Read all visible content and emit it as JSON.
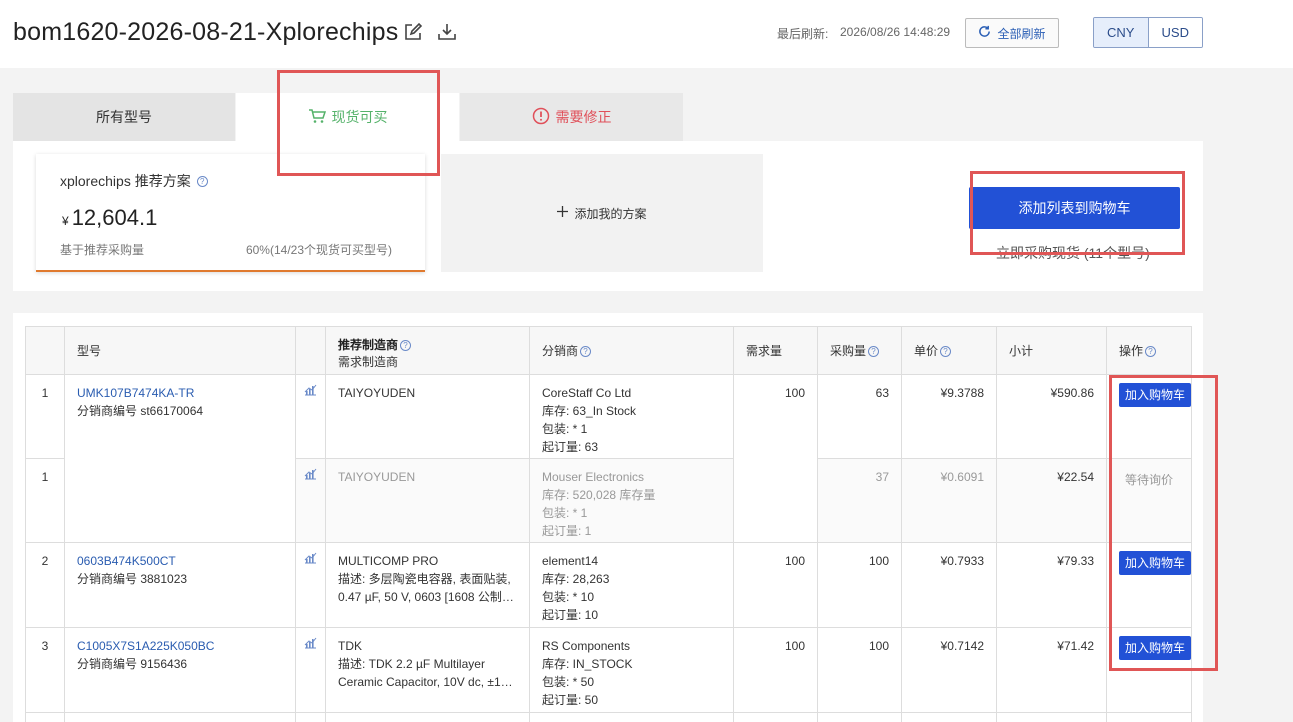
{
  "header": {
    "title": "bom1620-2026-08-21-Xplorechips",
    "refresh_label": "最后刷新:",
    "refresh_time": "2026/08/26 14:48:29",
    "refresh_all": "全部刷新",
    "currencies": [
      "CNY",
      "USD"
    ],
    "active_currency": "CNY"
  },
  "tabs": {
    "all": "所有型号",
    "in_stock": "现货可买",
    "needs_fix": "需要修正"
  },
  "plan_card": {
    "title": "xplorechips 推荐方案",
    "currency_symbol": "¥",
    "price": "12,604.1",
    "basis": "基于推荐采购量",
    "coverage": "60%(14/23个现货可买型号)"
  },
  "add_plan": "添加我的方案",
  "cart": {
    "add_list_button": "添加列表到购物车",
    "buy_now": "立即采购现货 (11个型号)"
  },
  "table": {
    "headers": {
      "part": "型号",
      "mfr_recommended": "推荐制造商",
      "mfr_required": "需求制造商",
      "distributor": "分销商",
      "demand_qty": "需求量",
      "purchase_qty": "采购量",
      "unit_price": "单价",
      "subtotal": "小计",
      "action": "操作"
    },
    "rows": [
      {
        "idx": "1",
        "part": "UMK107B7474KA-TR",
        "dist_no": "分销商编号 st66170064",
        "mfr": "TAIYOYUDEN",
        "desc": "",
        "distributor": "CoreStaff Co Ltd",
        "stock": "库存: 63_In Stock",
        "pack": "包装: * 1",
        "moq": "起订量: 63",
        "demand": "100",
        "purchase": "63",
        "price": "¥9.3788",
        "subtotal": "¥590.86",
        "action": "加入购物车"
      },
      {
        "idx": "1",
        "part": "",
        "dist_no": "",
        "mfr": "TAIYOYUDEN",
        "desc": "",
        "distributor": "Mouser Electronics",
        "stock": "库存: 520,028 库存量",
        "pack": "包装: * 1",
        "moq": "起订量: 1",
        "demand": "",
        "purchase": "37",
        "price": "¥0.6091",
        "subtotal": "¥22.54",
        "action": "等待询价"
      },
      {
        "idx": "2",
        "part": "0603B474K500CT",
        "dist_no": "分销商编号 3881023",
        "mfr": "MULTICOMP PRO",
        "desc1": "描述: 多层陶瓷电容器, 表面贴装,",
        "desc2": "0.47 µF, 50 V, 0603 [1608 公制], ...",
        "distributor": "element14",
        "stock": "库存: 28,263",
        "pack": "包装: * 10",
        "moq": "起订量: 10",
        "demand": "100",
        "purchase": "100",
        "price": "¥0.7933",
        "subtotal": "¥79.33",
        "action": "加入购物车"
      },
      {
        "idx": "3",
        "part": "C1005X7S1A225K050BC",
        "dist_no": "分销商编号 9156436",
        "mfr": "TDK",
        "desc1": "描述: TDK 2.2 µF Multilayer",
        "desc2": "Ceramic Capacitor, 10V dc, ±10...",
        "distributor": "RS Components",
        "stock": "库存: IN_STOCK",
        "pack": "包装: * 50",
        "moq": "起订量: 50",
        "demand": "100",
        "purchase": "100",
        "price": "¥0.7142",
        "subtotal": "¥71.42",
        "action": "加入购物车"
      }
    ]
  }
}
